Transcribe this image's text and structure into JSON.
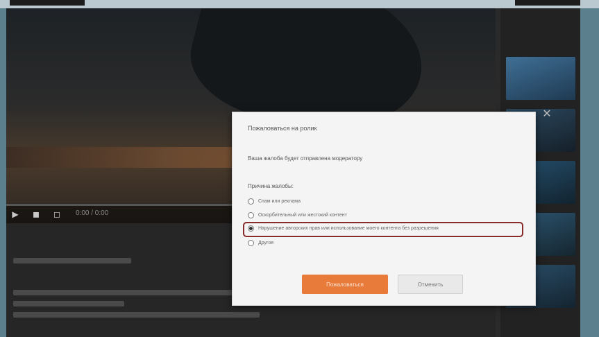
{
  "dialog": {
    "title": "Пожаловаться на ролик",
    "question": "Ваша жалоба будет отправлена модератору",
    "reason_label": "Причина жалобы:",
    "options": [
      {
        "label": "Спам или реклама",
        "selected": false
      },
      {
        "label": "Оскорбительный или жестокий контент",
        "selected": false
      },
      {
        "label": "Нарушение авторских прав или использование моего контента без разрешения",
        "selected": true
      },
      {
        "label": "Другое",
        "selected": false
      }
    ],
    "submit_label": "Пожаловаться",
    "cancel_label": "Отменить"
  },
  "player": {
    "time_text": "0:00 / 0:00",
    "progress_fraction": 0.0
  },
  "colors": {
    "accent": "#e87a3a",
    "highlight_border": "#8a2a2a"
  },
  "icons": [
    "play-icon",
    "volume-icon",
    "settings-icon",
    "close-icon"
  ]
}
